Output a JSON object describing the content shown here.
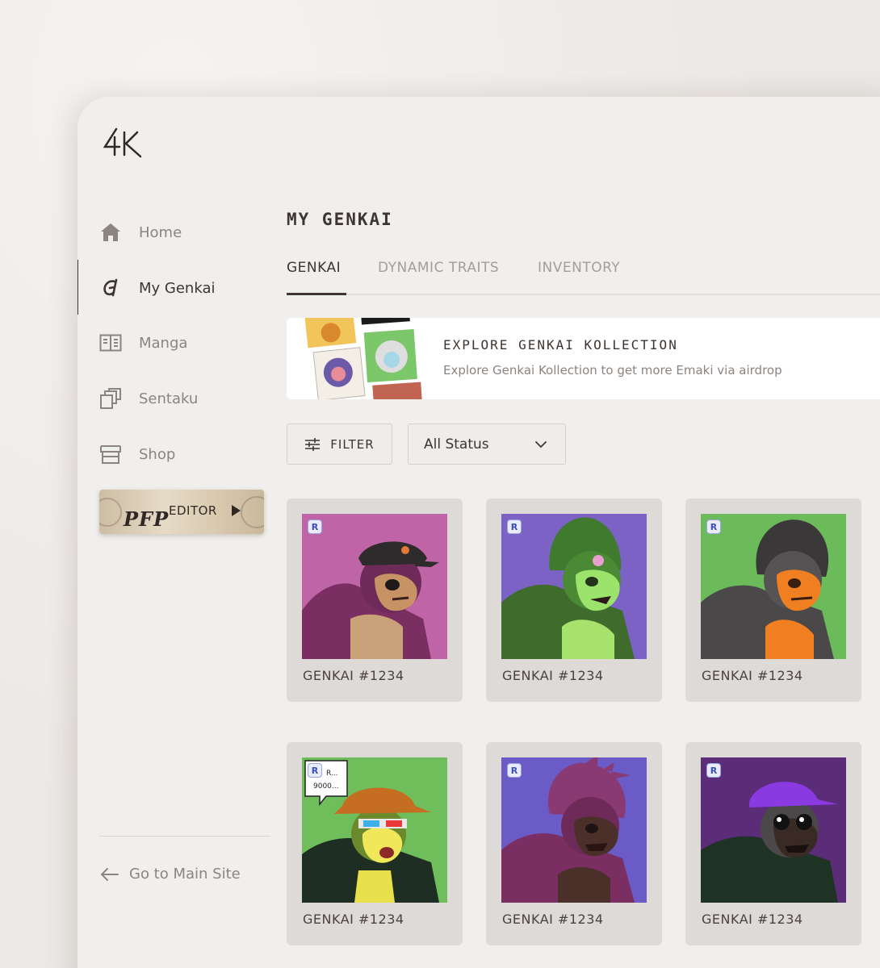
{
  "sidebar": {
    "items": [
      {
        "label": "Home",
        "icon": "home-icon"
      },
      {
        "label": "My Genkai",
        "icon": "genkai-icon"
      },
      {
        "label": "Manga",
        "icon": "book-icon"
      },
      {
        "label": "Sentaku",
        "icon": "layers-icon"
      },
      {
        "label": "Shop",
        "icon": "store-icon"
      }
    ],
    "pfp_editor": {
      "pfp": "PFP",
      "editor": "EDITOR"
    },
    "back_link": "Go to Main Site"
  },
  "main": {
    "title": "MY GENKAI",
    "tabs": [
      {
        "label": "GENKAI",
        "active": true
      },
      {
        "label": "DYNAMIC TRAITS",
        "active": false
      },
      {
        "label": "INVENTORY",
        "active": false
      }
    ],
    "banner": {
      "title": "EXPLORE GENKAI KOLLECTION",
      "subtitle": "Explore Genkai Kollection to get more Emaki via airdrop"
    },
    "filter_label": "FILTER",
    "status_select": "All Status",
    "cards": [
      {
        "label": "GENKAI #1234",
        "bg": "#c064a8"
      },
      {
        "label": "GENKAI #1234",
        "bg": "#7b62c4"
      },
      {
        "label": "GENKAI #1234",
        "bg": "#6cbb5a"
      },
      {
        "label": "GENKAI #1234",
        "bg": "#6fbe5b",
        "speech": "R... 9000..."
      },
      {
        "label": "GENKAI #1234",
        "bg": "#6a5bc6"
      },
      {
        "label": "GENKAI #1234",
        "bg": "#5b2d78"
      }
    ],
    "badge": "R"
  }
}
